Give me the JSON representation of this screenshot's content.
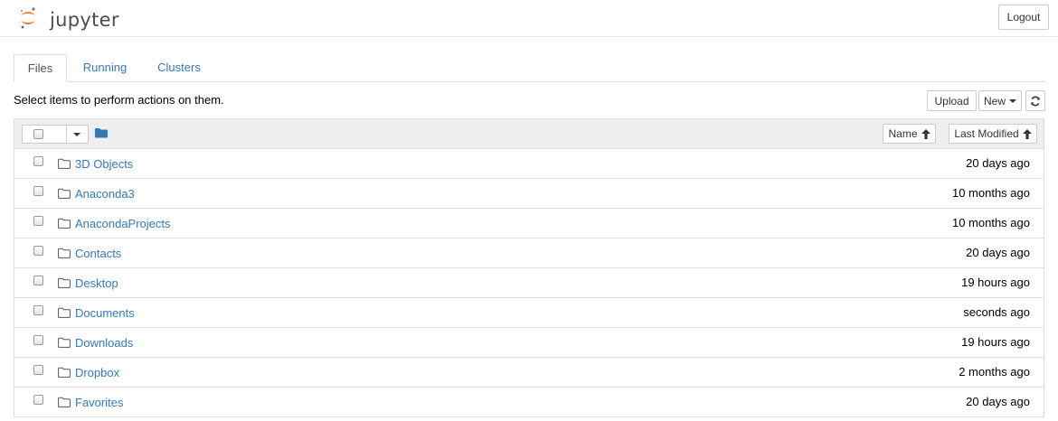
{
  "header": {
    "logo_text": "jupyter",
    "logout_label": "Logout"
  },
  "tabs": [
    {
      "label": "Files",
      "active": true
    },
    {
      "label": "Running",
      "active": false
    },
    {
      "label": "Clusters",
      "active": false
    }
  ],
  "toolbar": {
    "hint": "Select items to perform actions on them.",
    "upload_label": "Upload",
    "new_label": "New",
    "refresh_icon": "refresh-icon"
  },
  "list_header": {
    "folder_icon": "folder-icon",
    "sort_name_label": "Name",
    "sort_modified_label": "Last Modified"
  },
  "items": [
    {
      "name": "3D Objects",
      "modified": "20 days ago"
    },
    {
      "name": "Anaconda3",
      "modified": "10 months ago"
    },
    {
      "name": "AnacondaProjects",
      "modified": "10 months ago"
    },
    {
      "name": "Contacts",
      "modified": "20 days ago"
    },
    {
      "name": "Desktop",
      "modified": "19 hours ago"
    },
    {
      "name": "Documents",
      "modified": "seconds ago"
    },
    {
      "name": "Downloads",
      "modified": "19 hours ago"
    },
    {
      "name": "Dropbox",
      "modified": "2 months ago"
    },
    {
      "name": "Favorites",
      "modified": "20 days ago"
    }
  ],
  "colors": {
    "link": "#337ab7",
    "logo_orange": "#f37726",
    "header_bg": "#eeeeee",
    "border": "#dddddd"
  }
}
